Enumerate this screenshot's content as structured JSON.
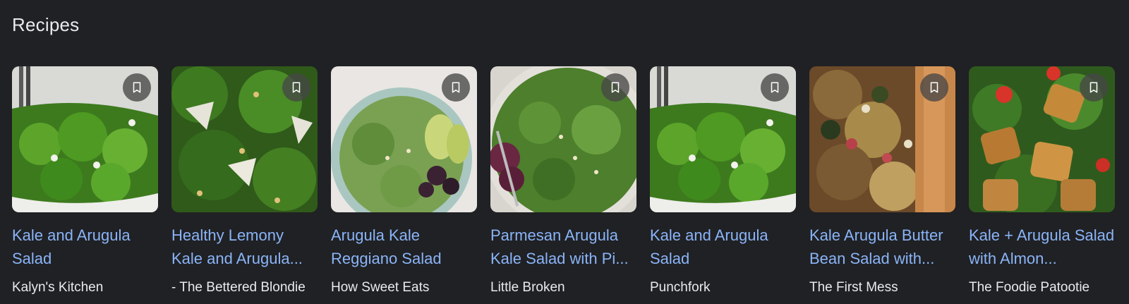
{
  "section": {
    "title": "Recipes"
  },
  "cards": [
    {
      "title": "Kale and Arugula Salad",
      "source": "Kalyn's Kitchen",
      "image": "kale-arugula-salad-bowl-photo"
    },
    {
      "title": "Healthy Lemony Kale and Arugula...",
      "source": "- The Bettered Blondie",
      "image": "lemony-kale-arugula-salad-photo"
    },
    {
      "title": "Arugula Kale Reggiano Salad",
      "source": "How Sweet Eats",
      "image": "arugula-kale-avocado-blackberry-bowl-photo"
    },
    {
      "title": "Parmesan Arugula Kale Salad with Pi...",
      "source": "Little Broken",
      "image": "parmesan-arugula-kale-salad-photo"
    },
    {
      "title": "Kale and Arugula Salad",
      "source": "Punchfork",
      "image": "kale-arugula-salad-bowl-photo"
    },
    {
      "title": "Kale Arugula Butter Bean Salad with...",
      "source": "The First Mess",
      "image": "butter-bean-salad-wooden-spoon-photo"
    },
    {
      "title": "Kale + Arugula Salad with Almon...",
      "source": "The Foodie Patootie",
      "image": "chicken-arugula-salad-photo"
    }
  ],
  "icons": {
    "bookmark": "bookmark-icon"
  },
  "colors": {
    "background": "#202124",
    "title_link": "#8ab4f8",
    "text": "#e8eaed"
  }
}
